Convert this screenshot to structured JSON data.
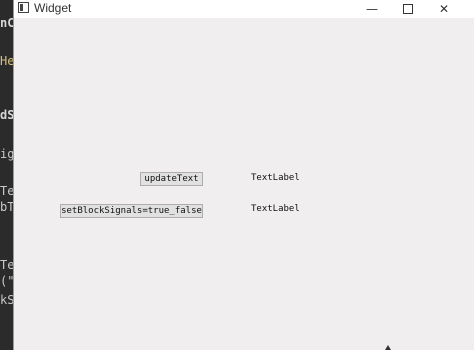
{
  "background_editor": {
    "fragments": [
      "nC",
      "He",
      "dS",
      "ig",
      "Te",
      "bT",
      "Te",
      "(\"",
      "kS"
    ]
  },
  "window": {
    "title": "Widget",
    "controls": {
      "minimize": "—",
      "close": "✕"
    }
  },
  "content": {
    "update_button_label": "updateText",
    "block_signals_button_label": "setBlockSignals=true_false",
    "label1_text": "TextLabel",
    "label2_text": "TextLabel"
  }
}
